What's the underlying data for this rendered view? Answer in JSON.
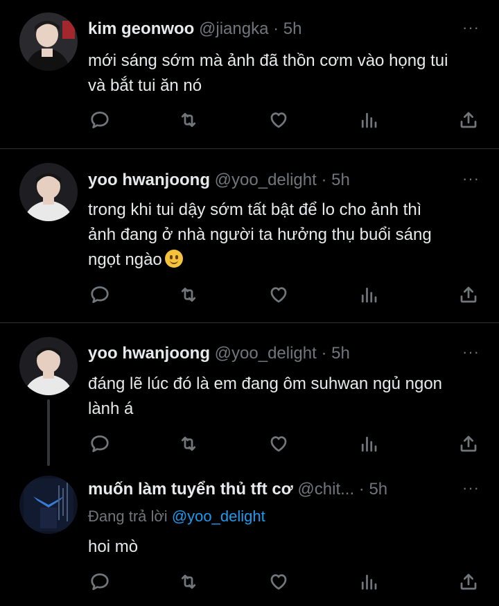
{
  "tweets": [
    {
      "name": "kim geonwoo",
      "handle": "@jiangka",
      "time": "· 5h",
      "more": "···",
      "lines": [
        "mới sáng sớm mà ảnh đã thồn cơm vào họng tui",
        "và bắt tui ăn nó"
      ]
    },
    {
      "name": "yoo hwanjoong",
      "handle": "@yoo_delight",
      "time": "· 5h",
      "more": "···",
      "lines": [
        "trong khi tui dậy sớm tất bật để lo cho ảnh thì",
        "ảnh đang ở nhà người ta hưởng thụ buổi sáng",
        "ngọt ngào"
      ]
    },
    {
      "name": "yoo hwanjoong",
      "handle": "@yoo_delight",
      "time": "· 5h",
      "more": "···",
      "lines": [
        "đáng lẽ lúc đó là em đang ôm suhwan ngủ ngon",
        "lành á"
      ]
    },
    {
      "name": "muốn làm tuyển thủ tft cơ",
      "handle": "@chit...",
      "time": "· 5h",
      "more": "···",
      "replying_prefix": "Đang trả lời",
      "replying_to": "@yoo_delight",
      "lines": [
        "hoi mò"
      ]
    }
  ],
  "icons": {
    "reply": "reply-icon",
    "retweet": "retweet-icon",
    "like": "heart-icon",
    "views": "views-icon",
    "share": "share-icon",
    "emoji": "slightly-smiling-face-emoji"
  },
  "colors": {
    "background": "#000000",
    "text": "#e7e9ea",
    "secondary": "#71767b",
    "mention": "#1d9bf0"
  }
}
